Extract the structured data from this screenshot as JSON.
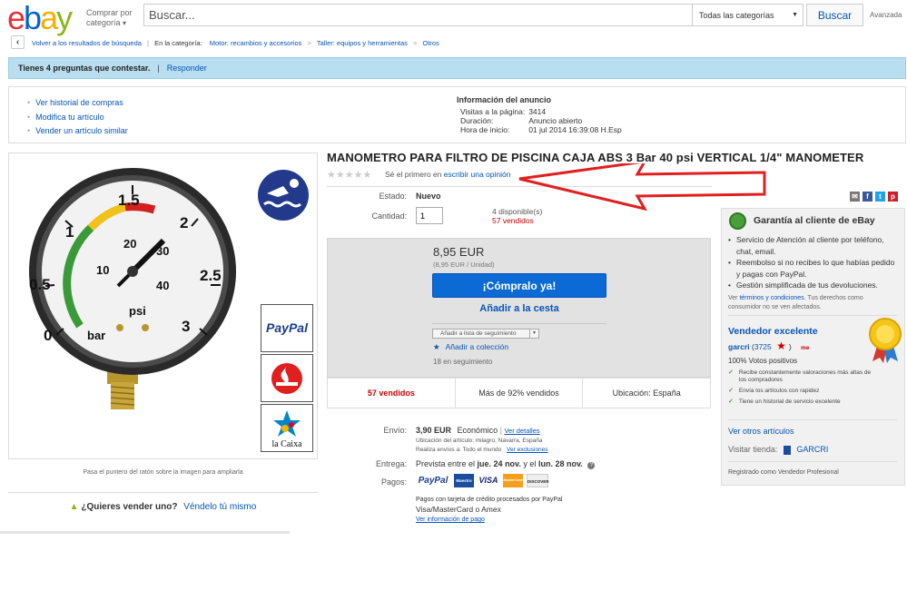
{
  "header": {
    "logo": "ebay",
    "browse_label_1": "Comprar por",
    "browse_label_2": "categoría",
    "search_placeholder": "Buscar...",
    "category_select": "Todas las categorías",
    "search_button": "Buscar",
    "advanced": "Avanzada"
  },
  "breadcrumb": {
    "back": "Volver a los resultados de búsqueda",
    "in_category": "En la categoría:",
    "items": [
      "Motor: recambios y accesorios",
      "Taller: equipos y herramientas",
      "Otros"
    ]
  },
  "notice": {
    "text": "Tienes 4 preguntas que contestar.",
    "action": "Responder"
  },
  "info_links": [
    "Ver historial de compras",
    "Modifica tu artículo",
    "Vender un artículo similar"
  ],
  "listing_info": {
    "heading": "Información del anuncio",
    "rows": [
      {
        "label": "Visitas a la página:",
        "value": "3414"
      },
      {
        "label": "Duración:",
        "value": "Anuncio abierto"
      },
      {
        "label": "Hora de inicio:",
        "value": "01 jul 2014 16:39:08 H.Esp"
      }
    ]
  },
  "image": {
    "hint": "Pasa el puntero del ratón sobre la imagen para ampliarla",
    "gauge_labels": [
      "0",
      "0.5",
      "1",
      "1.5",
      "2",
      "2.5",
      "3",
      "10",
      "20",
      "30",
      "40",
      "psi",
      "bar"
    ],
    "thumbs": [
      "PayPal",
      "la Caixa"
    ]
  },
  "sell": {
    "question": "¿Quieres vender uno?",
    "link": "Véndelo tú mismo"
  },
  "product": {
    "title": "MANOMETRO PARA FILTRO DE PISCINA CAJA ABS 3 Bar 40 psi VERTICAL 1/4\" MANOMETER",
    "rating_stars": 0,
    "review_prefix": "Sé el primero en",
    "review_link": "escribir una opinión",
    "condition_label": "Estado:",
    "condition": "Nuevo",
    "quantity_label": "Cantidad:",
    "quantity": "1",
    "available": "4 disponible(s)",
    "sold": "57 vendidos",
    "price": "8,95 EUR",
    "unit_price": "(8,95 EUR / Unidad)",
    "buy_now": "¡Cómpralo ya!",
    "add_to_cart": "Añadir a la cesta",
    "add_to_list": "Añadir a lista de seguimiento",
    "add_to_collection": "Añadir a colección",
    "following": "18 en seguimiento"
  },
  "stats": [
    "57 vendidos",
    "Más de 92% vendidos",
    "Ubicación: España"
  ],
  "shipping": {
    "label": "Envío:",
    "cost": "3,90 EUR",
    "method": "Económico",
    "details_link": "Ver detalles",
    "location": "Ubicación del artículo: milagro, Navarra, España",
    "ships_to_prefix": "Realiza envíos a:  Todo el mundo",
    "exclusions_link": "Ver exclusiones",
    "delivery_label": "Entrega:",
    "delivery_prefix": "Prevista entre el",
    "delivery_from": "jue. 24 nov.",
    "delivery_mid": "y el",
    "delivery_to": "lun. 28 nov.",
    "payments_label": "Pagos:",
    "pay_logos": [
      "PayPal",
      "Maestro",
      "VISA",
      "MasterCard",
      "DISCOVER"
    ],
    "pay_note": "Pagos con tarjeta de crédito procesados por PayPal",
    "pay_cards": "Visa/MasterCard o Amex",
    "pay_info_link": "Ver información de pago"
  },
  "guarantee": {
    "title": "Garantía al cliente de eBay",
    "items": [
      "Servicio de Atención al cliente por teléfono, chat, email.",
      "Reembolso si no recibes lo que habías pedido y pagas con PayPal.",
      "Gestión simplificada de tus devoluciones."
    ],
    "terms_prefix": "Ver",
    "terms_link": "términos y condiciones",
    "terms_suffix": ". Tus derechos como consumidor no se ven afectados."
  },
  "seller": {
    "badge": "Vendedor excelente",
    "name": "garcri",
    "score": "3725",
    "positive": "100% Votos positivos",
    "checks": [
      "Recibe constantemente valoraciones más altas de los compradores",
      "Envía los artículos con rapidez",
      "Tiene un historial de servicio excelente"
    ],
    "other_items": "Ver otros artículos",
    "visit_store": "Visitar tienda:",
    "store_name": "GARCRI",
    "registered": "Registrado como Vendedor Profesional"
  },
  "colors": {
    "link": "#0654ba",
    "buy_button": "#0b6ad4",
    "notice_bg": "#b8deef",
    "sold_red": "#cc0000",
    "annotation_arrow": "#e02020"
  }
}
